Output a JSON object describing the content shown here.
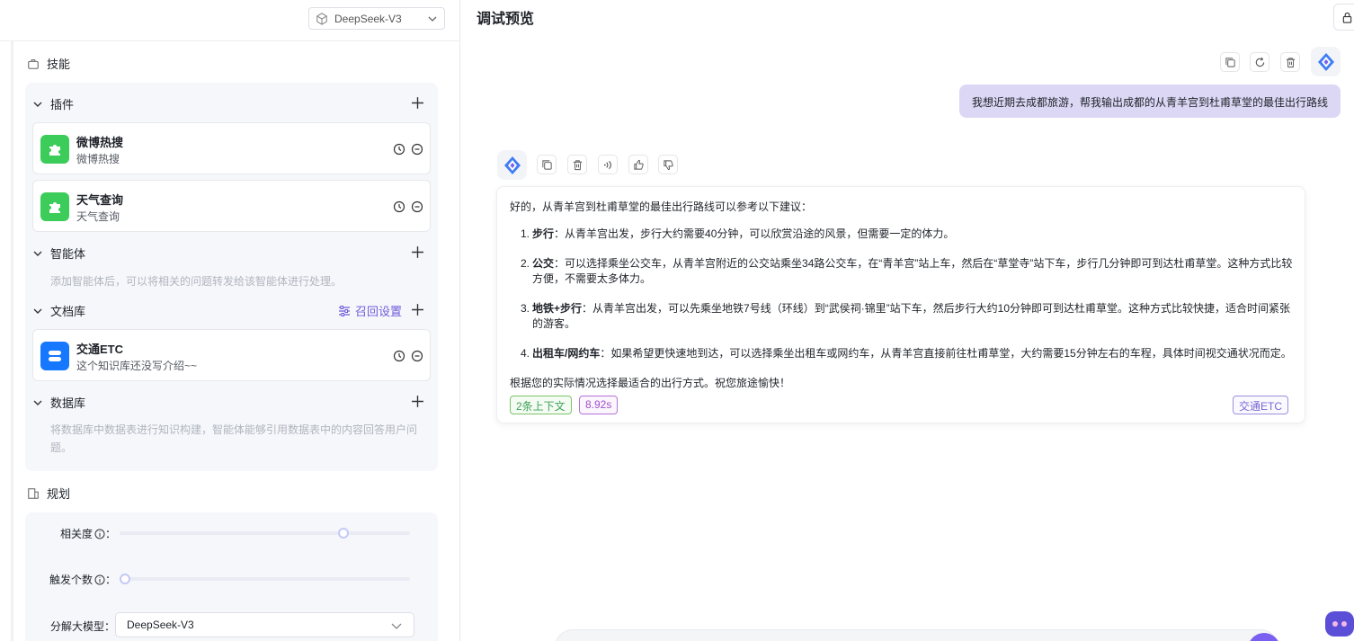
{
  "model_select": {
    "value": "DeepSeek-V3"
  },
  "skills": {
    "title": "技能"
  },
  "plugins": {
    "title": "插件",
    "items": [
      {
        "name": "微博热搜",
        "desc": "微博热搜"
      },
      {
        "name": "天气查询",
        "desc": "天气查询"
      }
    ]
  },
  "agents": {
    "title": "智能体",
    "desc": "添加智能体后，可以将相关的问题转发给该智能体进行处理。"
  },
  "docs": {
    "title": "文档库",
    "recall_label": "召回设置",
    "items": [
      {
        "name": "交通ETC",
        "desc": "这个知识库还没写介绍~~"
      }
    ]
  },
  "database": {
    "title": "数据库",
    "desc": "将数据库中数据表进行知识构建，智能体能够引用数据表中的内容回答用户问题。"
  },
  "planning": {
    "title": "规划",
    "relevance_label": "相关度",
    "relevance_colon": "：",
    "relevance_value": 0.78,
    "trigger_label": "触发个数",
    "trigger_colon": "：",
    "trigger_value": 0.0,
    "decompose_label": "分解大模型：",
    "decompose_value": "DeepSeek-V3"
  },
  "preview": {
    "title": "调试预览",
    "user_message": "我想近期去成都旅游，帮我输出成都的从青羊宫到杜甫草堂的最佳出行路线",
    "answer": {
      "intro": "好的，从青羊宫到杜甫草堂的最佳出行路线可以参考以下建议：",
      "items": [
        {
          "num": "1.",
          "title": "步行",
          "text": "：从青羊宫出发，步行大约需要40分钟，可以欣赏沿途的风景，但需要一定的体力。"
        },
        {
          "num": "2.",
          "title": "公交",
          "text": "：可以选择乘坐公交车，从青羊宫附近的公交站乘坐34路公交车，在“青羊宫”站上车，然后在“草堂寺”站下车，步行几分钟即可到达杜甫草堂。这种方式比较方便，不需要太多体力。"
        },
        {
          "num": "3.",
          "title": "地铁+步行",
          "text": "：从青羊宫出发，可以先乘坐地铁7号线（环线）到“武侯祠·锦里”站下车，然后步行大约10分钟即可到达杜甫草堂。这种方式比较快捷，适合时间紧张的游客。"
        },
        {
          "num": "4.",
          "title": "出租车/网约车",
          "text": "：如果希望更快速地到达，可以选择乘坐出租车或网约车，从青羊宫直接前往杜甫草堂，大约需要15分钟左右的车程，具体时间视交通状况而定。"
        }
      ],
      "outro": "根据您的实际情况选择最适合的出行方式。祝您旅途愉快！",
      "context_tag": "2条上下文",
      "time_tag": "8.92s",
      "source_tag": "交通ETC"
    }
  },
  "colors": {
    "accent": "#6e5ddb",
    "plugin_green": "#3ccc5a",
    "etc_blue": "#1677ff",
    "user_bubble": "#dcd7f5"
  }
}
